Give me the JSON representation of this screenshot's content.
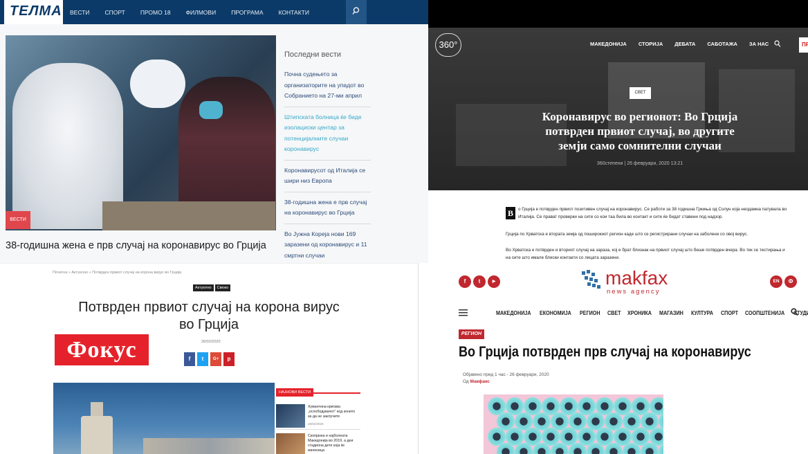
{
  "telma": {
    "logo": "ТЕЛМА",
    "menu": [
      "ВЕСТИ",
      "СПОРТ",
      "ПРОМО 18",
      "ФИЛМОВИ",
      "ПРОГРАМА",
      "КОНТАКТИ"
    ],
    "category_tag": "ВЕСТИ",
    "headline": "38-годишна жена е прв случај на коронавирус во Грција",
    "sidebar_title": "Последни вести",
    "latest": [
      "Почна судењето за организаторите на упадот во Собранието на 27-ми април",
      "Штипската болница ќе биде изолациски центар за потенцијалните случаи коронавирус",
      "Коронавирусот од Италија се шири низ Европа",
      "38-годишна жена е прв случај на коронавирус во Грција",
      "Во Јужна Кореја нови 169 заразени од коронавирус и 11 смртни случаи"
    ],
    "colors": {
      "nav": "#0b3a68",
      "tag": "#e0474c",
      "highlight": "#35a8c9"
    }
  },
  "stepeni": {
    "logo": "360°",
    "menu": [
      "МАКЕДОНИЈА",
      "СТОРИЈА",
      "ДЕБАТА",
      "САБОТАЖА",
      "ЗА НАС"
    ],
    "cut_label": "ПР",
    "tag": "СВЕТ",
    "title": "Коронавирус во регионот: Во Грција потврден првиот случај, во другите земји само сомнителни случаи",
    "meta": "360степени | 26 февруари, 2020 13:21",
    "dropcap": "В",
    "paragraphs": [
      "о Грција е потврден првиот позитивен случај на коронавирус. Се работи за 38 годишна Гркиња од Солун која неодамна патувала во Италија. Се прават проверки на сите со кои таа била во контакт и сите ќе бидат ставени под надзор.",
      "Грција по Хрватска е втората земја од поширокиот регион каде што се регистрирани случаи на заболени со овој вирус.",
      "Во Хрватска е потврден и вториот случај на зараза, кој е брат близнак на првиот случај што беше потврден вчера. Во тек се тестирања и на сите што имале блиски контакти со лицата заразени."
    ]
  },
  "fokus": {
    "breadcrumb": "Почетна » Актуелно » Потврден првиот случај на корона вирус во Грција",
    "tags": [
      "Актуелно",
      "Свежо"
    ],
    "title": "Потврден првиот случај на корона вирус во Грција",
    "logo": "Фокус",
    "date": "26/02/2020",
    "share": [
      "f",
      "t",
      "G+",
      "p"
    ],
    "latest_label": "НАЈНОВИ ВЕСТИ",
    "latest": [
      {
        "text": "Хумантина кригава „ослободувачот“ код конито за да не заклучите",
        "date": "26/02/2020"
      },
      {
        "text": "Скопјанка и најболеата Македонија во 2019, а деи стадиона дете која ќе маченица",
        "date": ""
      }
    ]
  },
  "makfax": {
    "social": [
      "f",
      "t",
      "▶"
    ],
    "lang": [
      "EN",
      "Ф"
    ],
    "logo_word": "makfax",
    "logo_sub": "news agency",
    "menu": [
      "МАКЕДОНИЈА",
      "ЕКОНОМИЈА",
      "РЕГИОН",
      "СВЕТ",
      "ХРОНИКА",
      "МАГАЗИН",
      "КУЛТУРА",
      "СПОРТ",
      "СООПШТЕНИЈА",
      "СТУДИО"
    ],
    "tag": "РЕГИОН",
    "title": "Во Грција потврден прв случај на коронавирус",
    "meta": "Објавено пред 1 час - 26 февруари, 2020",
    "author_prefix": "Од",
    "author": "Макфакс",
    "colors": {
      "brand": "#c0282f"
    }
  }
}
